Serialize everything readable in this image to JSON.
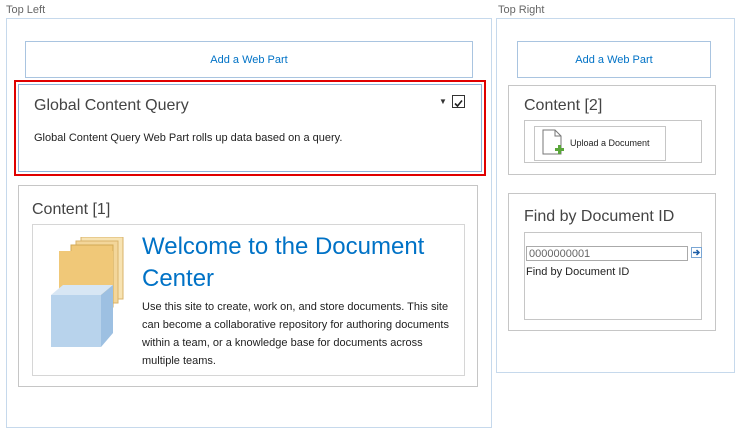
{
  "zones": {
    "top_left": {
      "label": "Top Left",
      "add_web_part": "Add a Web Part"
    },
    "top_right": {
      "label": "Top Right",
      "add_web_part": "Add a Web Part"
    }
  },
  "global_content_query": {
    "title": "Global Content Query",
    "description": "Global Content Query Web Part rolls up data based on a query.",
    "menu_icon": "dropdown-arrow-icon",
    "checked": true
  },
  "content_1": {
    "title": "Content [1]",
    "welcome_title": "Welcome to the Document Center",
    "welcome_text": "Use this site to create, work on, and store documents. This site can become a collaborative repository for authoring documents within a team, or a knowledge base for documents across multiple teams.",
    "image_icon": "folder-document-icon"
  },
  "content_2": {
    "title": "Content [2]",
    "upload_label": "Upload a Document",
    "upload_icon": "document-add-icon"
  },
  "find_by_id": {
    "title": "Find by Document ID",
    "input_value": "0000000001",
    "caption": "Find by Document ID",
    "go_icon": "arrow-go-icon"
  },
  "colors": {
    "link": "#0072c6",
    "selection_border": "#e00000",
    "zone_border": "#c6d9ec",
    "folder_yellow": "#f0c878",
    "folder_blue": "#b8d3ec"
  }
}
